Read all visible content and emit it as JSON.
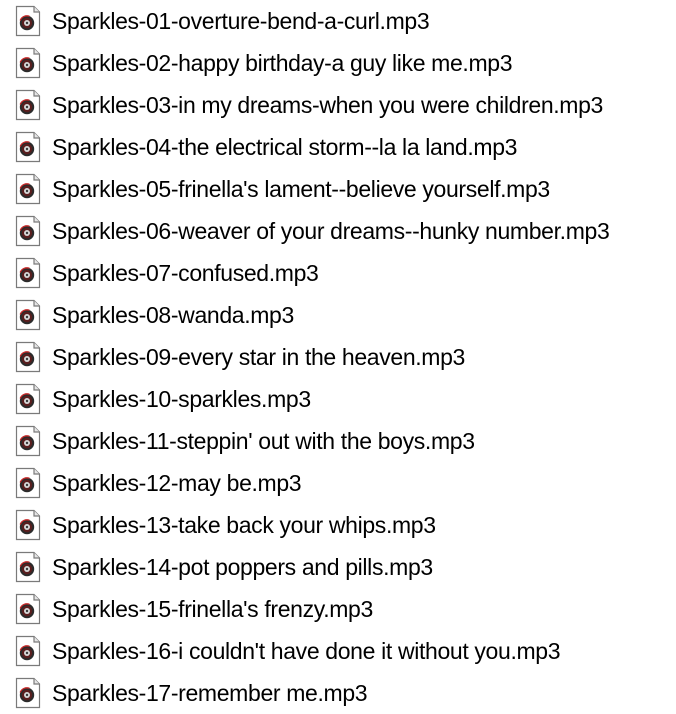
{
  "file_icon": "mp3-audio-file-icon",
  "files": [
    {
      "name": "Sparkles-01-overture-bend-a-curl.mp3"
    },
    {
      "name": "Sparkles-02-happy birthday-a guy like me.mp3"
    },
    {
      "name": "Sparkles-03-in my dreams-when you were children.mp3"
    },
    {
      "name": "Sparkles-04-the electrical storm--la la land.mp3"
    },
    {
      "name": "Sparkles-05-frinella's lament--believe yourself.mp3"
    },
    {
      "name": "Sparkles-06-weaver of your dreams--hunky number.mp3"
    },
    {
      "name": "Sparkles-07-confused.mp3"
    },
    {
      "name": "Sparkles-08-wanda.mp3"
    },
    {
      "name": "Sparkles-09-every star in the heaven.mp3"
    },
    {
      "name": "Sparkles-10-sparkles.mp3"
    },
    {
      "name": "Sparkles-11-steppin' out with the boys.mp3"
    },
    {
      "name": "Sparkles-12-may be.mp3"
    },
    {
      "name": "Sparkles-13-take back your whips.mp3"
    },
    {
      "name": "Sparkles-14-pot poppers and pills.mp3"
    },
    {
      "name": "Sparkles-15-frinella's frenzy.mp3"
    },
    {
      "name": "Sparkles-16-i couldn't have done it without you.mp3"
    },
    {
      "name": "Sparkles-17-remember me.mp3"
    }
  ]
}
